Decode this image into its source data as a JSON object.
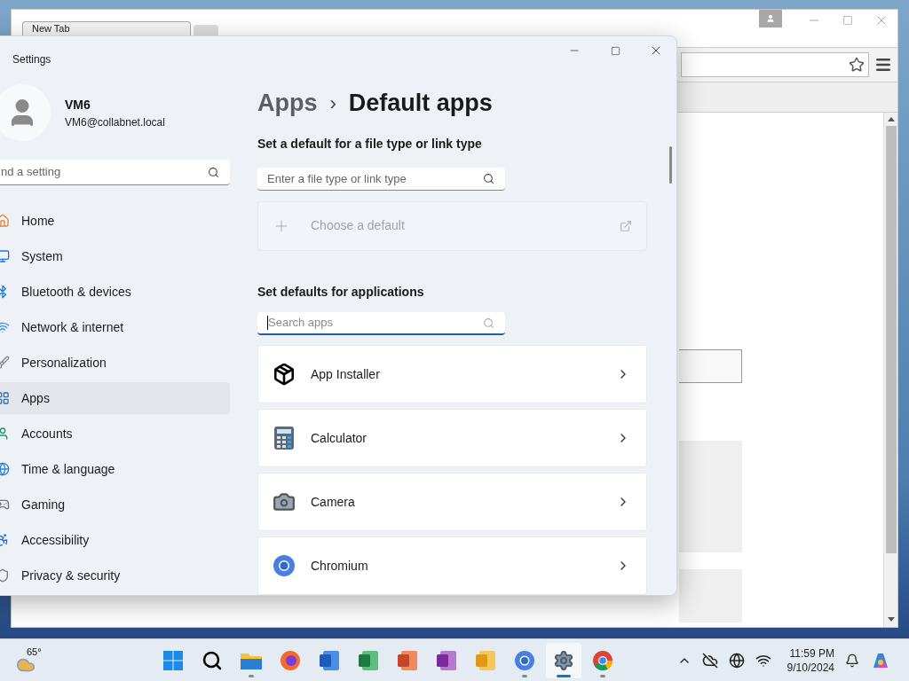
{
  "browser": {
    "tab": {
      "label": "New Tab"
    }
  },
  "settings": {
    "title": "Settings",
    "user": {
      "name": "VM6",
      "email": "VM6@collabnet.local"
    },
    "search": {
      "placeholder": "nd a setting"
    },
    "nav": [
      {
        "label": "Home",
        "kind": "home",
        "selected": false
      },
      {
        "label": "System",
        "kind": "system",
        "selected": false
      },
      {
        "label": "Bluetooth & devices",
        "kind": "bluetooth",
        "selected": false
      },
      {
        "label": "Network & internet",
        "kind": "network",
        "selected": false
      },
      {
        "label": "Personalization",
        "kind": "personalization",
        "selected": false
      },
      {
        "label": "Apps",
        "kind": "apps",
        "selected": true
      },
      {
        "label": "Accounts",
        "kind": "accounts",
        "selected": false
      },
      {
        "label": "Time & language",
        "kind": "time",
        "selected": false
      },
      {
        "label": "Gaming",
        "kind": "gaming",
        "selected": false
      },
      {
        "label": "Accessibility",
        "kind": "accessibility",
        "selected": false
      },
      {
        "label": "Privacy & security",
        "kind": "privacy",
        "selected": false
      }
    ],
    "breadcrumb": {
      "parent": "Apps",
      "separator": "›",
      "current": "Default apps"
    },
    "file_section": {
      "heading": "Set a default for a file type or link type",
      "search": {
        "placeholder": "Enter a file type or link type"
      },
      "choose": {
        "label": "Choose a default",
        "disabled": true
      }
    },
    "apps_section": {
      "heading": "Set defaults for applications",
      "search": {
        "placeholder": "Search apps",
        "focused": true
      },
      "apps": [
        {
          "name": "App Installer",
          "kind": "installer"
        },
        {
          "name": "Calculator",
          "kind": "calculator"
        },
        {
          "name": "Camera",
          "kind": "camera"
        },
        {
          "name": "Chromium",
          "kind": "chromium"
        }
      ]
    }
  },
  "taskbar": {
    "weather": "65°",
    "pinned": [
      {
        "kind": "start",
        "running": false,
        "selected": false
      },
      {
        "kind": "search",
        "running": false,
        "selected": false
      },
      {
        "kind": "explorer",
        "running": true,
        "selected": false
      },
      {
        "kind": "firefox",
        "running": false,
        "selected": false
      },
      {
        "kind": "word",
        "running": false,
        "selected": false
      },
      {
        "kind": "excel",
        "running": false,
        "selected": false
      },
      {
        "kind": "powerpoint",
        "running": false,
        "selected": false
      },
      {
        "kind": "onenote",
        "running": false,
        "selected": false
      },
      {
        "kind": "outlook",
        "running": false,
        "selected": false
      },
      {
        "kind": "chromium",
        "running": true,
        "selected": false
      },
      {
        "kind": "settings",
        "running": true,
        "selected": true
      },
      {
        "kind": "chrome",
        "running": true,
        "selected": false
      }
    ],
    "time": "11:59 PM",
    "date": "9/10/2024"
  }
}
